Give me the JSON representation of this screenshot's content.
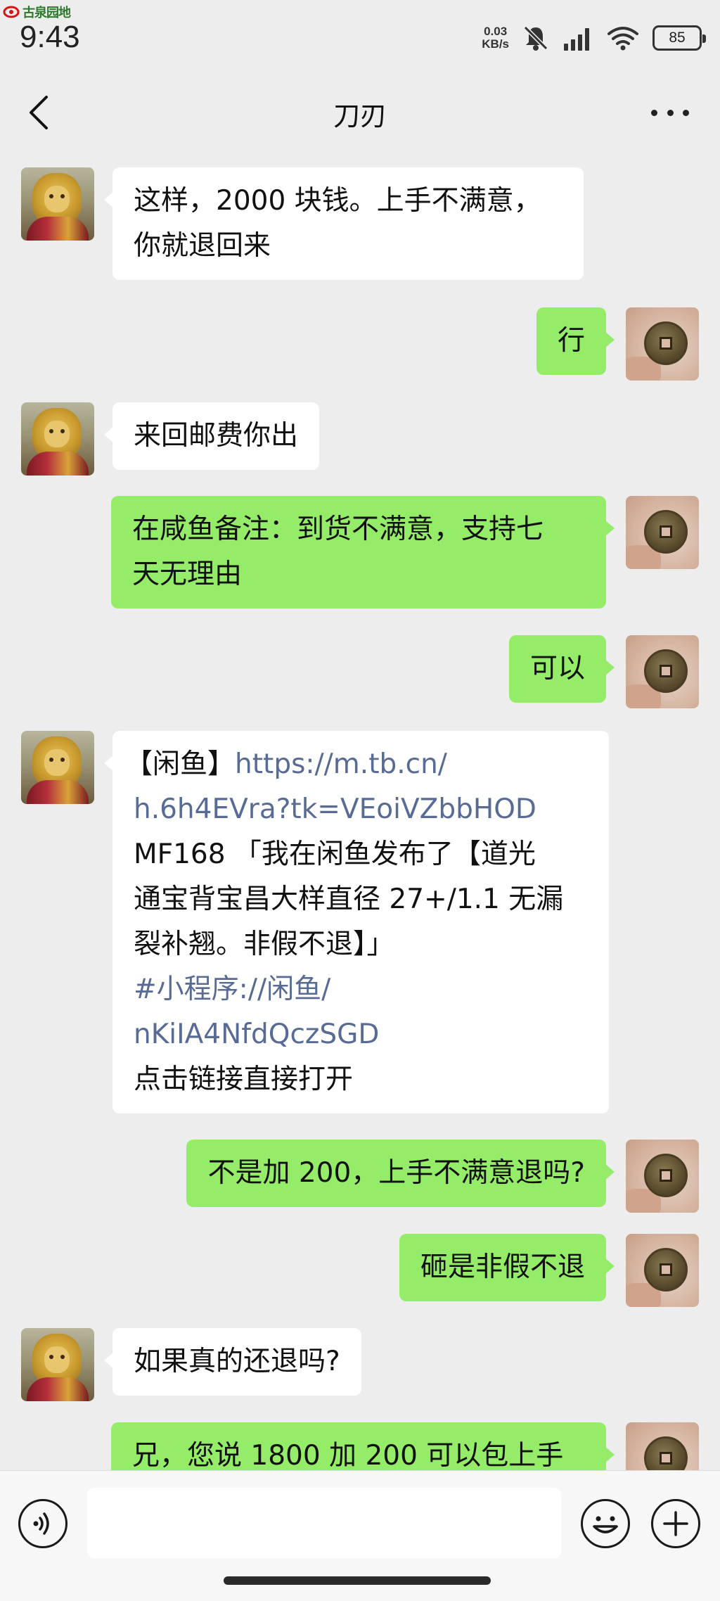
{
  "watermark": {
    "text": "古泉园地"
  },
  "status_bar": {
    "time": "9:43",
    "net_speed_value": "0.03",
    "net_speed_unit": "KB/s",
    "battery": "85",
    "icons": [
      "mute-bell-icon",
      "signal-icon",
      "wifi-icon",
      "battery-icon"
    ]
  },
  "header": {
    "title": "刀刃",
    "back_icon": "chevron-left-icon",
    "more_icon": "more-dots-icon"
  },
  "messages": [
    {
      "side": "left",
      "lines": [
        "这样，2000 块钱。上手不满意，",
        "你就退回来"
      ]
    },
    {
      "side": "right",
      "lines": [
        "行"
      ]
    },
    {
      "side": "left",
      "lines": [
        "来回邮费你出"
      ]
    },
    {
      "side": "right",
      "lines": [
        "在咸鱼备注：到货不满意，支持七",
        "天无理由"
      ]
    },
    {
      "side": "right",
      "lines": [
        "可以"
      ]
    },
    {
      "side": "left",
      "label": "【闲鱼】",
      "link1": [
        "https://m.tb.cn/",
        "h.6h4EVra?tk=VEoiVZbbHOD"
      ],
      "text1": [
        "MF168 「我在闲鱼发布了【道光",
        "通宝背宝昌大样直径 27+/1.1 无漏",
        "裂补翘。非假不退】」"
      ],
      "link2": [
        "#小程序://闲鱼/",
        "nKiIA4NfdQczSGD"
      ],
      "text2": "点击链接直接打开"
    },
    {
      "side": "right",
      "lines": [
        "不是加 200，上手不满意退吗?"
      ]
    },
    {
      "side": "right",
      "lines": [
        "砸是非假不退"
      ]
    },
    {
      "side": "left",
      "lines": [
        "如果真的还退吗?"
      ]
    },
    {
      "side": "right",
      "lines": [
        "兄，您说 1800 加 200 可以包上手"
      ]
    }
  ],
  "bottom_bar": {
    "voice_icon": "voice-icon",
    "emoji_icon": "emoji-icon",
    "plus_icon": "plus-icon",
    "input_value": ""
  }
}
